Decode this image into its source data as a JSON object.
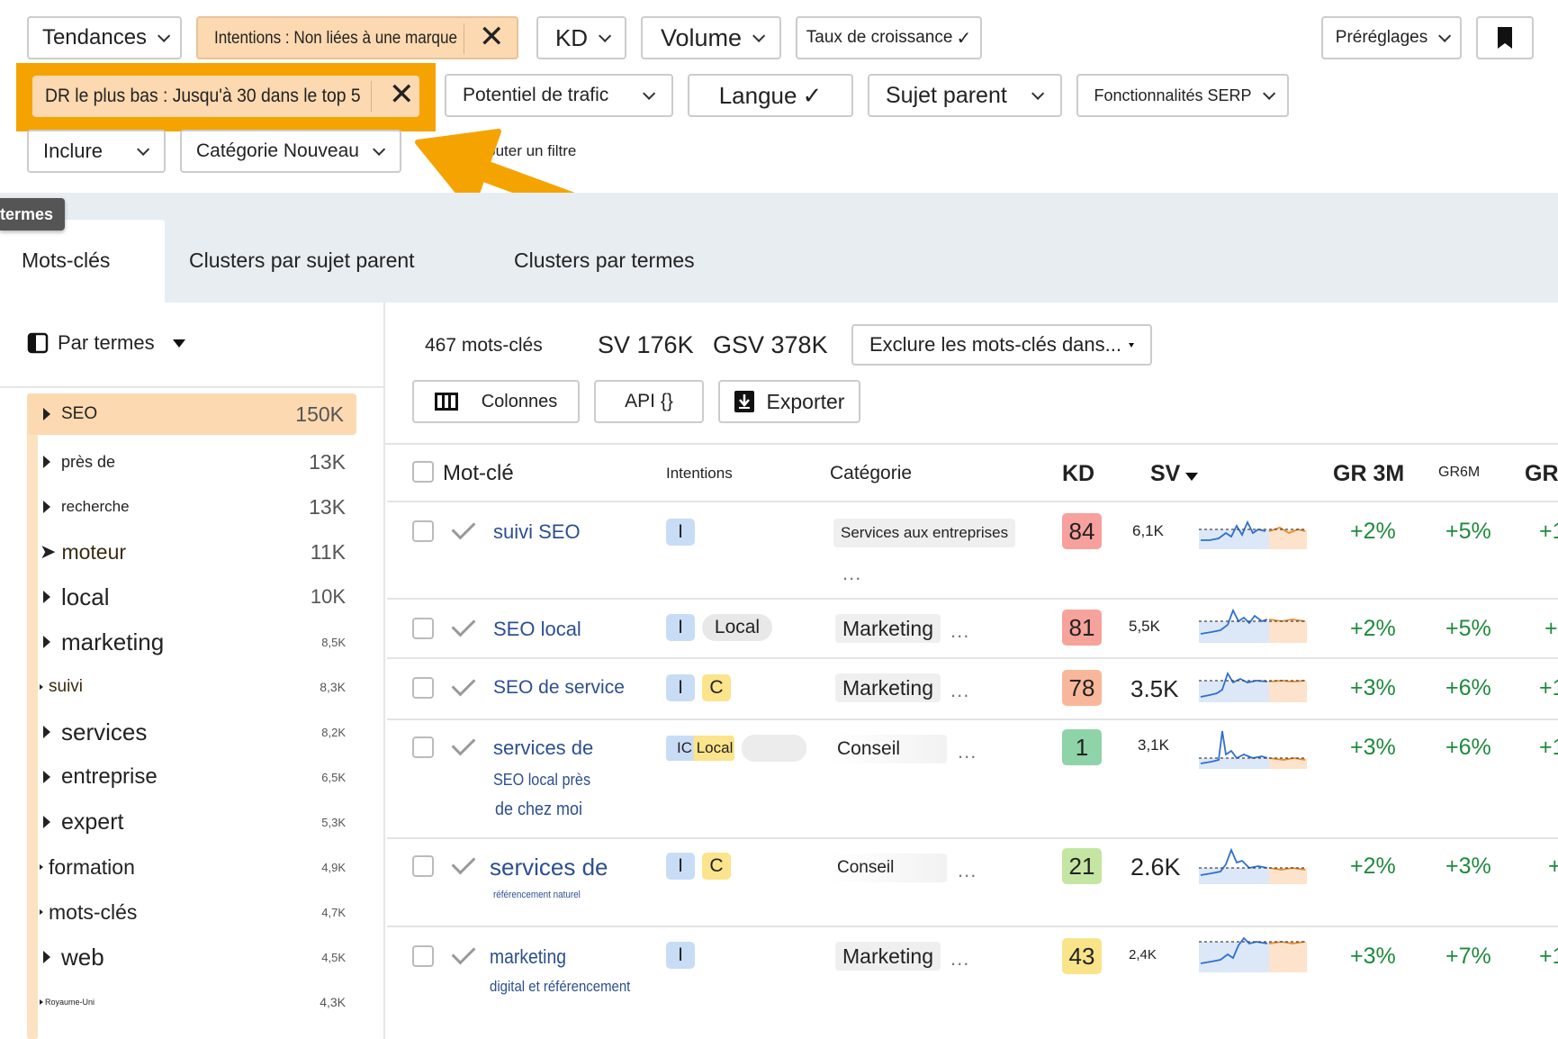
{
  "filters": {
    "row1": {
      "tendances": "Tendances",
      "intentions": "Intentions : Non liées à une marque",
      "kd": "KD",
      "volume": "Volume",
      "taux": "Taux de croissance",
      "preglages": "Préréglages"
    },
    "row2": {
      "dr": "DR le plus bas : Jusqu'à 30 dans le top 5",
      "potentiel": "Potentiel de trafic",
      "langue": "Langue",
      "sujet_parent": "Sujet parent",
      "serp": "Fonctionnalités SERP"
    },
    "row3": {
      "inclure": "Inclure",
      "categorie": "Catégorie Nouveau",
      "ajouter": "Ajouter un filtre"
    },
    "tooltip": "termes"
  },
  "tabs": [
    "Mots-clés",
    "Clusters par sujet parent",
    "Clusters par termes"
  ],
  "sidebar": {
    "header": "Par termes",
    "items": [
      {
        "label": "SEO",
        "count": "150K"
      },
      {
        "label": "près de",
        "count": "13K"
      },
      {
        "label": "recherche",
        "count": "13K"
      },
      {
        "label": "moteur",
        "count": "11K"
      },
      {
        "label": "local",
        "count": "10K"
      },
      {
        "label": "marketing",
        "count": "8,5K"
      },
      {
        "label": "suivi",
        "count": "8,3K"
      },
      {
        "label": "services",
        "count": "8,2K"
      },
      {
        "label": "entreprise",
        "count": "6,5K"
      },
      {
        "label": "expert",
        "count": "5,3K"
      },
      {
        "label": "formation",
        "count": "4,9K"
      },
      {
        "label": "mots-clés",
        "count": "4,7K"
      },
      {
        "label": "web",
        "count": "4,5K"
      },
      {
        "label": "Royaume-Uni",
        "count": "4,3K"
      }
    ]
  },
  "summary": {
    "count": "467 mots-clés",
    "sv": "SV 176K",
    "gsv": "GSV 378K",
    "exclude": "Exclure les mots-clés dans..."
  },
  "toolbar": {
    "colonnes": "Colonnes",
    "api": "API {}",
    "exporter": "Exporter"
  },
  "table": {
    "headers": {
      "keyword": "Mot-clé",
      "intentions": "Intentions",
      "category": "Catégorie",
      "kd": "KD",
      "sv": "SV",
      "gr3m": "GR 3M",
      "gr6m": "GR6M",
      "gr": "GR"
    },
    "rows": [
      {
        "kw1": "suivi SEO",
        "kw2": "",
        "kw3": "",
        "intents": [
          "I"
        ],
        "category": "Services aux entreprises",
        "kd": "84",
        "kd_color": "#f7a09d",
        "sv": "6,1K",
        "gr3m": "+2%",
        "gr6m": "+5%",
        "gr": "+1"
      },
      {
        "kw1": "SEO local",
        "kw2": "",
        "kw3": "",
        "intents": [
          "I",
          "Local"
        ],
        "category": "Marketing",
        "kd": "81",
        "kd_color": "#f6a39b",
        "sv": "5,5K",
        "gr3m": "+2%",
        "gr6m": "+5%",
        "gr": "+"
      },
      {
        "kw1": "SEO de service",
        "kw2": "",
        "kw3": "",
        "intents": [
          "I",
          "C"
        ],
        "category": "Marketing",
        "kd": "78",
        "kd_color": "#f8b79b",
        "sv": "3.5K",
        "gr3m": "+3%",
        "gr6m": "+6%",
        "gr": "+1"
      },
      {
        "kw1": "services de",
        "kw2": "SEO local près",
        "kw3": "de chez moi",
        "intents": [
          "IC Local"
        ],
        "category": "Conseil",
        "kd": "1",
        "kd_color": "#8fd3a8",
        "sv": "3,1K",
        "gr3m": "+3%",
        "gr6m": "+6%",
        "gr": "+1"
      },
      {
        "kw1": "services de",
        "kw2": "référencement naturel",
        "kw3": "",
        "intents": [
          "I",
          "C"
        ],
        "category": "Conseil",
        "kd": "21",
        "kd_color": "#c4e6a2",
        "sv": "2.6K",
        "gr3m": "+2%",
        "gr6m": "+3%",
        "gr": "+"
      },
      {
        "kw1": "marketing",
        "kw2": "digital et référencement",
        "kw3": "",
        "intents": [
          "I"
        ],
        "category": "Marketing",
        "kd": "43",
        "kd_color": "#f9e48a",
        "sv": "2,4K",
        "gr3m": "+3%",
        "gr6m": "+7%",
        "gr": "+1"
      }
    ]
  },
  "colors": {
    "accent_orange": "#f5a300",
    "highlight": "#fcd9b0",
    "link_blue": "#2c4f8f",
    "positive_green": "#1e8a3c"
  }
}
